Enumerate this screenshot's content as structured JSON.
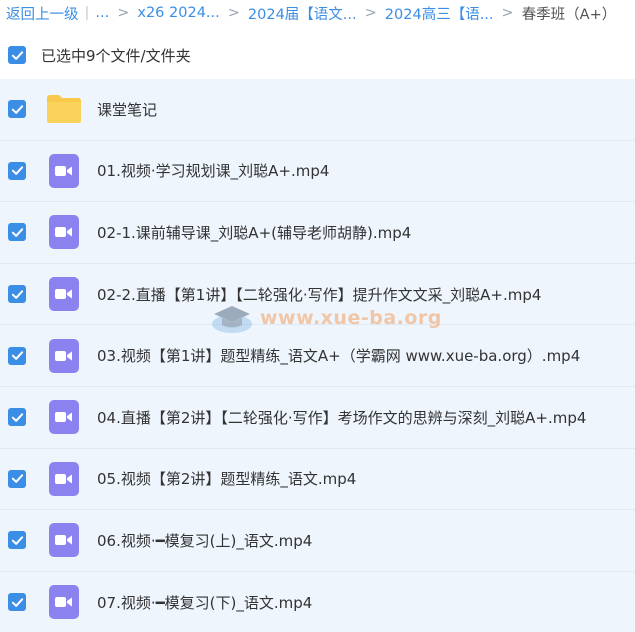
{
  "breadcrumb": {
    "back_label": "返回上一级",
    "separator_bar": "|",
    "crumbs": [
      "...",
      "x26 2024...",
      "2024届【语文...",
      "2024高三【语..."
    ],
    "separator": ">",
    "current": "春季班（A+）"
  },
  "selection": {
    "summary": "已选中9个文件/文件夹"
  },
  "files": [
    {
      "type": "folder",
      "name": "课堂笔记"
    },
    {
      "type": "video",
      "name": "01.视频·学习规划课_刘聪A+.mp4"
    },
    {
      "type": "video",
      "name": "02-1.课前辅导课_刘聪A+(辅导老师胡静).mp4"
    },
    {
      "type": "video",
      "name": "02-2.直播【第1讲】【二轮强化·写作】提升作文文采_刘聪A+.mp4"
    },
    {
      "type": "video",
      "name": "03.视频【第1讲】题型精练_语文A+（学霸网 www.xue-ba.org）.mp4"
    },
    {
      "type": "video",
      "name": "04.直播【第2讲】【二轮强化·写作】考场作文的思辨与深刻_刘聪A+.mp4"
    },
    {
      "type": "video",
      "name": "05.视频【第2讲】题型精练_语文.mp4"
    },
    {
      "type": "video",
      "name": "06.视频·━模复习(上)_语文.mp4"
    },
    {
      "type": "video",
      "name": "07.视频·━模复习(下)_语文.mp4"
    }
  ],
  "watermark": {
    "text": "www.xue-ba.org"
  },
  "colors": {
    "accent": "#3a8ee6",
    "row_bg": "#eef5fd",
    "video_icon": "#8b82f0",
    "folder_icon": "#f9c94c"
  }
}
